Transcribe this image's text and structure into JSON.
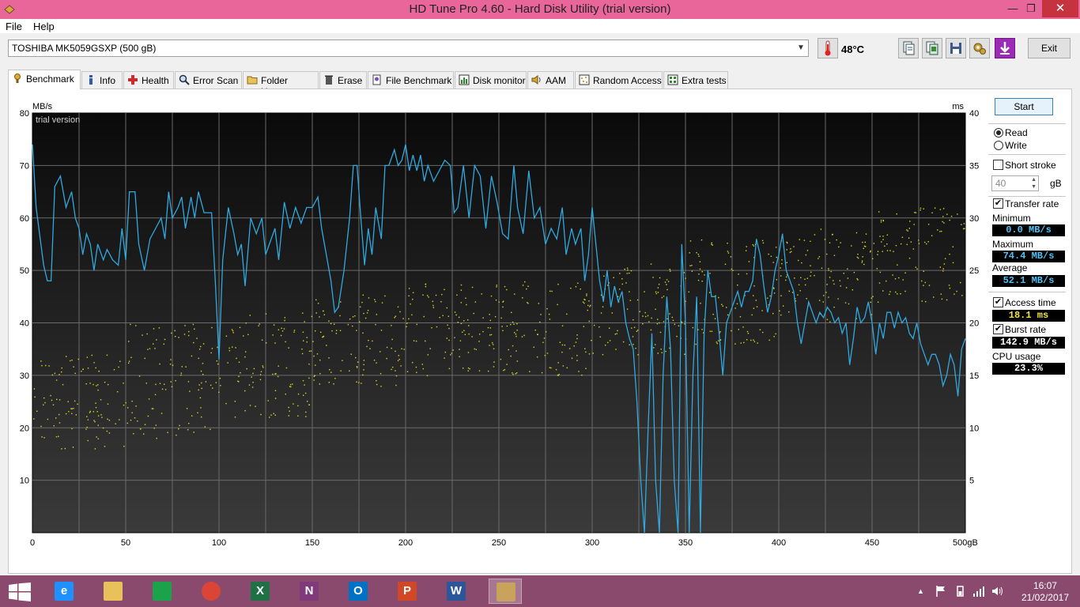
{
  "window": {
    "title": "HD Tune Pro 4.60 - Hard Disk Utility (trial version)",
    "minimize_glyph": "—",
    "restore_glyph": "❐",
    "close_glyph": "✕"
  },
  "menu": {
    "file": "File",
    "help": "Help"
  },
  "toolbar": {
    "drive": "TOSHIBA MK5059GSXP (500 gB)",
    "temperature": "48°C",
    "icons": [
      "copy-info-icon",
      "copy-screen-icon",
      "save-icon",
      "options-icon",
      "download-icon"
    ],
    "exit": "Exit"
  },
  "tabs": [
    {
      "label": "Benchmark",
      "icon": "benchmark-icon"
    },
    {
      "label": "Info",
      "icon": "info-icon"
    },
    {
      "label": "Health",
      "icon": "health-icon"
    },
    {
      "label": "Error Scan",
      "icon": "error-scan-icon"
    },
    {
      "label": "Folder Usage",
      "icon": "folder-icon"
    },
    {
      "label": "Erase",
      "icon": "erase-icon"
    },
    {
      "label": "File Benchmark",
      "icon": "file-benchmark-icon"
    },
    {
      "label": "Disk monitor",
      "icon": "disk-monitor-icon"
    },
    {
      "label": "AAM",
      "icon": "speaker-icon"
    },
    {
      "label": "Random Access",
      "icon": "random-access-icon"
    },
    {
      "label": "Extra tests",
      "icon": "extra-tests-icon"
    }
  ],
  "benchmark": {
    "start": "Start",
    "read": "Read",
    "write": "Write",
    "mode": "read",
    "short_stroke": {
      "label": "Short stroke",
      "checked": false,
      "value": "40",
      "unit": "gB"
    },
    "transfer_rate": {
      "label": "Transfer rate",
      "checked": true
    },
    "minimum": {
      "label": "Minimum",
      "value": "0.0 MB/s"
    },
    "maximum": {
      "label": "Maximum",
      "value": "74.4 MB/s"
    },
    "average": {
      "label": "Average",
      "value": "52.1 MB/s"
    },
    "access_time": {
      "label": "Access time",
      "checked": true,
      "value": "18.1 ms"
    },
    "burst_rate": {
      "label": "Burst rate",
      "checked": true,
      "value": "142.9 MB/s"
    },
    "cpu_usage": {
      "label": "CPU usage",
      "value": "23.3%"
    }
  },
  "chart_data": {
    "type": "line",
    "watermark": "trial version",
    "xlabel": "gB",
    "ylabel": "MB/s",
    "y2label": "ms",
    "xlim": [
      0,
      500
    ],
    "ylim": [
      0,
      80
    ],
    "y2lim": [
      0,
      40
    ],
    "xticks": [
      "0",
      "50",
      "100",
      "150",
      "200",
      "250",
      "300",
      "350",
      "400",
      "450",
      "500gB"
    ],
    "yticks": [
      "10",
      "20",
      "30",
      "40",
      "50",
      "60",
      "70",
      "80"
    ],
    "y2ticks": [
      "5",
      "10",
      "15",
      "20",
      "25",
      "30",
      "35",
      "40"
    ],
    "grid": true,
    "colors": {
      "transfer": "#2fa9e0",
      "access": "#d8d820",
      "background": "#111111",
      "grid": "#6a6a6a"
    },
    "series": [
      {
        "values": [
          [
            0,
            74
          ],
          [
            2,
            62
          ],
          [
            6,
            51
          ],
          [
            8,
            48
          ],
          [
            10,
            48
          ],
          [
            12,
            66
          ],
          [
            15,
            68
          ],
          [
            18,
            62
          ],
          [
            21,
            65
          ],
          [
            23,
            60
          ],
          [
            25,
            58
          ],
          [
            27,
            53
          ],
          [
            29,
            57
          ],
          [
            31,
            55
          ],
          [
            33,
            50
          ],
          [
            35,
            55
          ],
          [
            38,
            52
          ],
          [
            40,
            54
          ],
          [
            43,
            52
          ],
          [
            46,
            51
          ],
          [
            48,
            58
          ],
          [
            50,
            52
          ],
          [
            52,
            65
          ],
          [
            55,
            65
          ],
          [
            57,
            55
          ],
          [
            60,
            50
          ],
          [
            63,
            56
          ],
          [
            66,
            58
          ],
          [
            69,
            60
          ],
          [
            71,
            56
          ],
          [
            73,
            65
          ],
          [
            75,
            60
          ],
          [
            78,
            62
          ],
          [
            80,
            64
          ],
          [
            82,
            58
          ],
          [
            85,
            64
          ],
          [
            87,
            60
          ],
          [
            89,
            65
          ],
          [
            92,
            61
          ],
          [
            96,
            61
          ],
          [
            98,
            48
          ],
          [
            100,
            33
          ],
          [
            102,
            52
          ],
          [
            105,
            62
          ],
          [
            108,
            57
          ],
          [
            110,
            53
          ],
          [
            112,
            55
          ],
          [
            114,
            47
          ],
          [
            117,
            60
          ],
          [
            120,
            57
          ],
          [
            123,
            60
          ],
          [
            125,
            53
          ],
          [
            127,
            55
          ],
          [
            130,
            58
          ],
          [
            132,
            52
          ],
          [
            135,
            63
          ],
          [
            138,
            58
          ],
          [
            141,
            62
          ],
          [
            144,
            59
          ],
          [
            147,
            62
          ],
          [
            150,
            62
          ],
          [
            153,
            64
          ],
          [
            155,
            58
          ],
          [
            158,
            52
          ],
          [
            160,
            48
          ],
          [
            162,
            42
          ],
          [
            164,
            43
          ],
          [
            167,
            50
          ],
          [
            170,
            60
          ],
          [
            172,
            70
          ],
          [
            174,
            70
          ],
          [
            176,
            60
          ],
          [
            178,
            51
          ],
          [
            180,
            58
          ],
          [
            182,
            53
          ],
          [
            184,
            62
          ],
          [
            187,
            56
          ],
          [
            189,
            70
          ],
          [
            191,
            70
          ],
          [
            194,
            73
          ],
          [
            196,
            70
          ],
          [
            198,
            71
          ],
          [
            200,
            74
          ],
          [
            202,
            69
          ],
          [
            204,
            72
          ],
          [
            206,
            69
          ],
          [
            208,
            72
          ],
          [
            210,
            67
          ],
          [
            212,
            70
          ],
          [
            215,
            67
          ],
          [
            218,
            69
          ],
          [
            221,
            71
          ],
          [
            224,
            70
          ],
          [
            226,
            61
          ],
          [
            228,
            62
          ],
          [
            231,
            70
          ],
          [
            234,
            60
          ],
          [
            237,
            70
          ],
          [
            240,
            68
          ],
          [
            243,
            58
          ],
          [
            246,
            68
          ],
          [
            249,
            63
          ],
          [
            252,
            57
          ],
          [
            255,
            56
          ],
          [
            258,
            70
          ],
          [
            260,
            62
          ],
          [
            263,
            57
          ],
          [
            266,
            69
          ],
          [
            269,
            60
          ],
          [
            272,
            62
          ],
          [
            275,
            55
          ],
          [
            278,
            58
          ],
          [
            281,
            56
          ],
          [
            284,
            62
          ],
          [
            286,
            53
          ],
          [
            289,
            58
          ],
          [
            291,
            55
          ],
          [
            294,
            58
          ],
          [
            296,
            48
          ],
          [
            298,
            53
          ],
          [
            300,
            62
          ],
          [
            302,
            55
          ],
          [
            304,
            48
          ],
          [
            306,
            44
          ],
          [
            308,
            50
          ],
          [
            310,
            43
          ],
          [
            312,
            47
          ],
          [
            314,
            44
          ],
          [
            316,
            46
          ],
          [
            318,
            40
          ],
          [
            320,
            37
          ],
          [
            322,
            35
          ],
          [
            324,
            25
          ],
          [
            326,
            10
          ],
          [
            328,
            0
          ],
          [
            330,
            20
          ],
          [
            332,
            38
          ],
          [
            334,
            10
          ],
          [
            336,
            0
          ],
          [
            338,
            30
          ],
          [
            340,
            45
          ],
          [
            342,
            35
          ],
          [
            344,
            10
          ],
          [
            346,
            0
          ],
          [
            348,
            55
          ],
          [
            350,
            40
          ],
          [
            352,
            0
          ],
          [
            354,
            30
          ],
          [
            356,
            45
          ],
          [
            358,
            0
          ],
          [
            360,
            38
          ],
          [
            362,
            50
          ],
          [
            364,
            45
          ],
          [
            366,
            45
          ],
          [
            368,
            38
          ],
          [
            370,
            30
          ],
          [
            372,
            40
          ],
          [
            374,
            42
          ],
          [
            376,
            44
          ],
          [
            378,
            46
          ],
          [
            380,
            43
          ],
          [
            382,
            46
          ],
          [
            384,
            46
          ],
          [
            386,
            48
          ],
          [
            388,
            56
          ],
          [
            390,
            53
          ],
          [
            392,
            47
          ],
          [
            394,
            42
          ],
          [
            396,
            45
          ],
          [
            398,
            50
          ],
          [
            400,
            53
          ],
          [
            402,
            57
          ],
          [
            404,
            50
          ],
          [
            406,
            48
          ],
          [
            408,
            46
          ],
          [
            410,
            40
          ],
          [
            412,
            36
          ],
          [
            414,
            40
          ],
          [
            416,
            44
          ],
          [
            418,
            42
          ],
          [
            420,
            40
          ],
          [
            422,
            42
          ],
          [
            424,
            41
          ],
          [
            426,
            43
          ],
          [
            428,
            42
          ],
          [
            430,
            40
          ],
          [
            432,
            41
          ],
          [
            434,
            38
          ],
          [
            436,
            40
          ],
          [
            438,
            32
          ],
          [
            440,
            37
          ],
          [
            442,
            43
          ],
          [
            444,
            40
          ],
          [
            446,
            41
          ],
          [
            448,
            44
          ],
          [
            450,
            40
          ],
          [
            452,
            34
          ],
          [
            454,
            40
          ],
          [
            456,
            37
          ],
          [
            458,
            42
          ],
          [
            460,
            42
          ],
          [
            462,
            39
          ],
          [
            464,
            42
          ],
          [
            466,
            40
          ],
          [
            468,
            41
          ],
          [
            470,
            38
          ],
          [
            472,
            37
          ],
          [
            474,
            40
          ],
          [
            476,
            36
          ],
          [
            478,
            34
          ],
          [
            480,
            32
          ],
          [
            482,
            34
          ],
          [
            484,
            34
          ],
          [
            486,
            32
          ],
          [
            488,
            28
          ],
          [
            490,
            30
          ],
          [
            492,
            34
          ],
          [
            494,
            32
          ],
          [
            496,
            26
          ],
          [
            498,
            35
          ],
          [
            500,
            37
          ]
        ]
      }
    ],
    "scatter_bands": [
      {
        "x_from": 0,
        "x_to": 50,
        "ms_from": 8,
        "ms_to": 17
      },
      {
        "x_from": 50,
        "x_to": 100,
        "ms_from": 9,
        "ms_to": 20
      },
      {
        "x_from": 100,
        "x_to": 150,
        "ms_from": 11,
        "ms_to": 21
      },
      {
        "x_from": 150,
        "x_to": 200,
        "ms_from": 14,
        "ms_to": 23
      },
      {
        "x_from": 200,
        "x_to": 250,
        "ms_from": 15,
        "ms_to": 24
      },
      {
        "x_from": 250,
        "x_to": 300,
        "ms_from": 15,
        "ms_to": 24
      },
      {
        "x_from": 300,
        "x_to": 350,
        "ms_from": 17,
        "ms_to": 26
      },
      {
        "x_from": 350,
        "x_to": 400,
        "ms_from": 18,
        "ms_to": 28
      },
      {
        "x_from": 400,
        "x_to": 450,
        "ms_from": 20,
        "ms_to": 29
      },
      {
        "x_from": 450,
        "x_to": 500,
        "ms_from": 22,
        "ms_to": 31
      }
    ]
  },
  "taskbar": {
    "apps": [
      {
        "name": "internet-explorer-icon",
        "letter": "e",
        "color": "#1e90ff",
        "active": false
      },
      {
        "name": "file-explorer-icon",
        "letter": "",
        "color": "#e8c15a",
        "active": false
      },
      {
        "name": "store-icon",
        "letter": "",
        "color": "#1aa34a",
        "active": false
      },
      {
        "name": "chrome-icon",
        "letter": "",
        "color": "#db4437",
        "active": false
      },
      {
        "name": "excel-icon",
        "letter": "X",
        "color": "#1e7145",
        "active": false
      },
      {
        "name": "onenote-icon",
        "letter": "N",
        "color": "#80397b",
        "active": false
      },
      {
        "name": "outlook-icon",
        "letter": "O",
        "color": "#0072c6",
        "active": false
      },
      {
        "name": "powerpoint-icon",
        "letter": "P",
        "color": "#d24726",
        "active": false
      },
      {
        "name": "word-icon",
        "letter": "W",
        "color": "#2b579a",
        "active": false
      },
      {
        "name": "hdtune-icon",
        "letter": "",
        "color": "#c9a35a",
        "active": true
      }
    ],
    "time": "16:07",
    "date": "21/02/2017"
  }
}
